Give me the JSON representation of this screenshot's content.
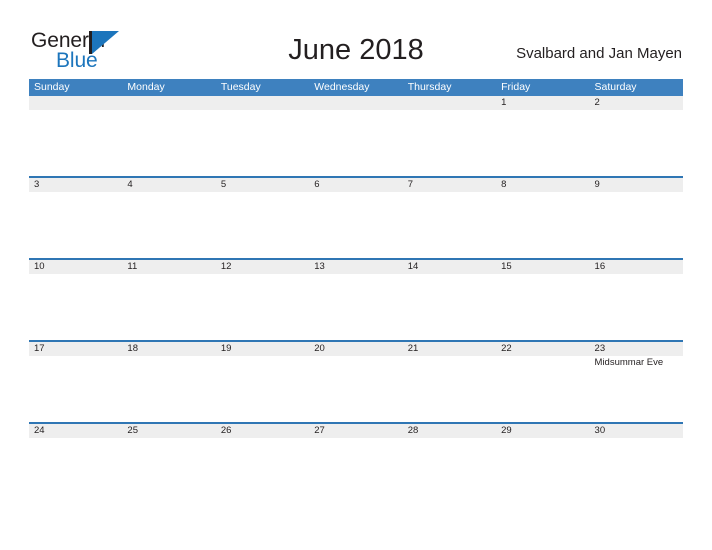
{
  "brand": {
    "name_part1": "General",
    "name_part2": "Blue",
    "color_black": "#231f20",
    "color_blue": "#1c75bc"
  },
  "header": {
    "month_title": "June 2018",
    "locale": "Svalbard and Jan Mayen"
  },
  "theme": {
    "header_blue": "#3e81bf",
    "rule_blue": "#2f76b4",
    "band_gray": "#eeeeee",
    "text": "#231f20"
  },
  "calendar": {
    "weekdays": [
      "Sunday",
      "Monday",
      "Tuesday",
      "Wednesday",
      "Thursday",
      "Friday",
      "Saturday"
    ],
    "weeks": [
      {
        "days": [
          {
            "num": "",
            "events": []
          },
          {
            "num": "",
            "events": []
          },
          {
            "num": "",
            "events": []
          },
          {
            "num": "",
            "events": []
          },
          {
            "num": "",
            "events": []
          },
          {
            "num": "1",
            "events": []
          },
          {
            "num": "2",
            "events": []
          }
        ]
      },
      {
        "days": [
          {
            "num": "3",
            "events": []
          },
          {
            "num": "4",
            "events": []
          },
          {
            "num": "5",
            "events": []
          },
          {
            "num": "6",
            "events": []
          },
          {
            "num": "7",
            "events": []
          },
          {
            "num": "8",
            "events": []
          },
          {
            "num": "9",
            "events": []
          }
        ]
      },
      {
        "days": [
          {
            "num": "10",
            "events": []
          },
          {
            "num": "11",
            "events": []
          },
          {
            "num": "12",
            "events": []
          },
          {
            "num": "13",
            "events": []
          },
          {
            "num": "14",
            "events": []
          },
          {
            "num": "15",
            "events": []
          },
          {
            "num": "16",
            "events": []
          }
        ]
      },
      {
        "days": [
          {
            "num": "17",
            "events": []
          },
          {
            "num": "18",
            "events": []
          },
          {
            "num": "19",
            "events": []
          },
          {
            "num": "20",
            "events": []
          },
          {
            "num": "21",
            "events": []
          },
          {
            "num": "22",
            "events": []
          },
          {
            "num": "23",
            "events": [
              "Midsummar Eve"
            ]
          }
        ]
      },
      {
        "days": [
          {
            "num": "24",
            "events": []
          },
          {
            "num": "25",
            "events": []
          },
          {
            "num": "26",
            "events": []
          },
          {
            "num": "27",
            "events": []
          },
          {
            "num": "28",
            "events": []
          },
          {
            "num": "29",
            "events": []
          },
          {
            "num": "30",
            "events": []
          }
        ]
      }
    ]
  }
}
